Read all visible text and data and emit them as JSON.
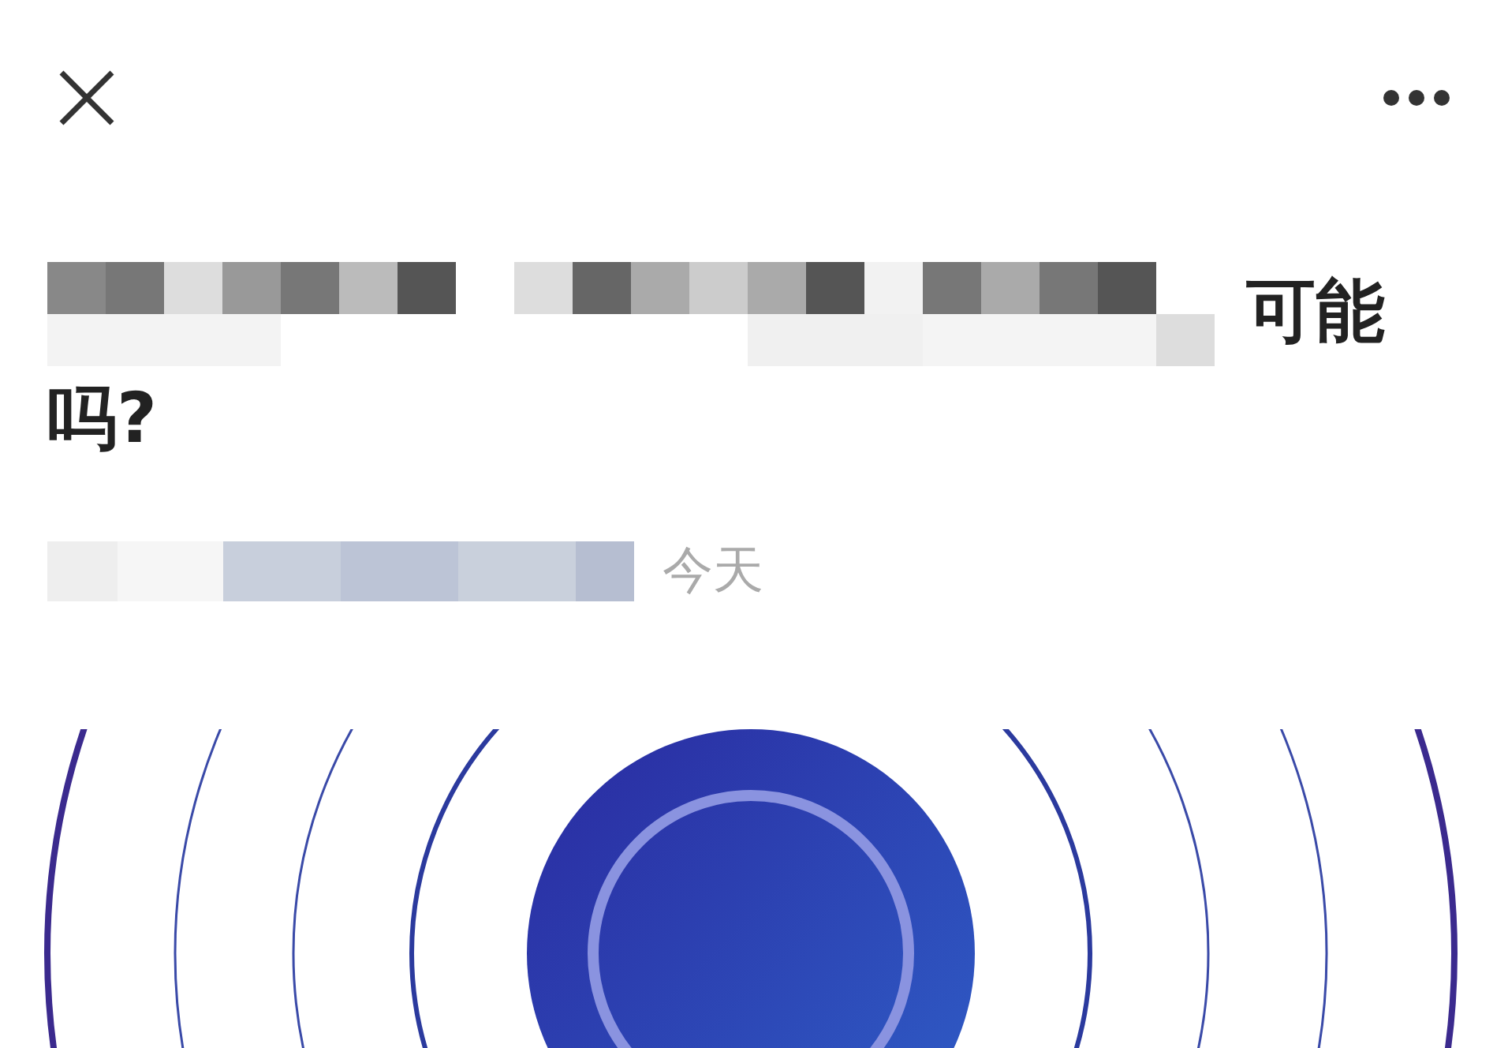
{
  "article": {
    "title_lines": [
      "可能",
      "吗?"
    ],
    "date": "今天"
  }
}
